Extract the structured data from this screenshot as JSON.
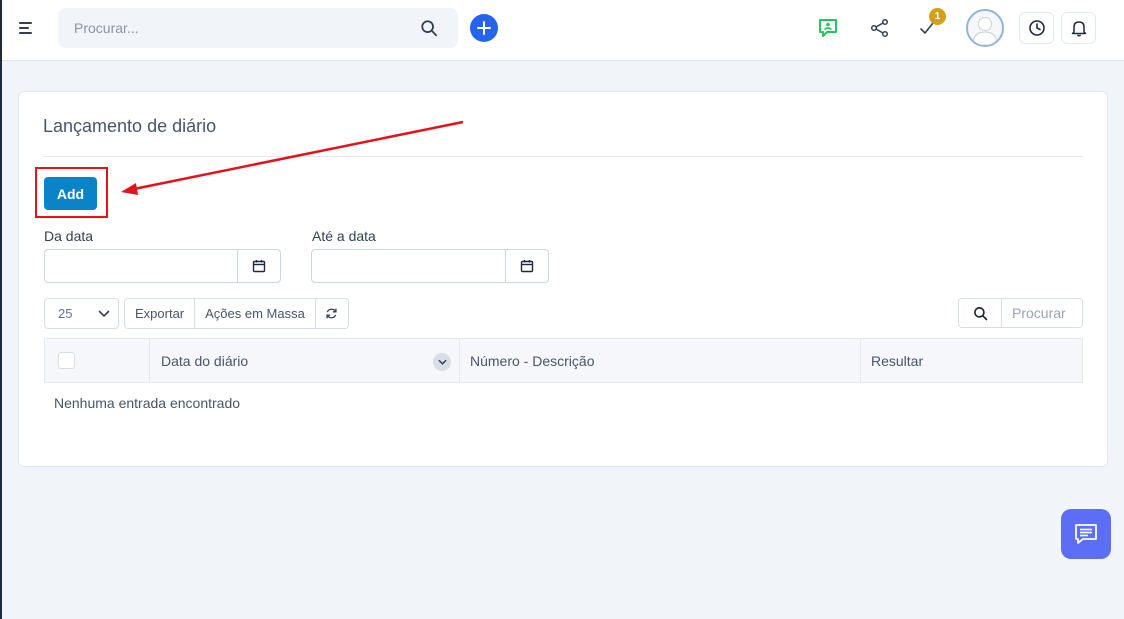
{
  "topbar": {
    "search_placeholder": "Procurar...",
    "notification_count": "1"
  },
  "card": {
    "title": "Lançamento de diário",
    "add_label": "Add",
    "from_date_label": "Da data",
    "to_date_label": "Até a data",
    "page_length": "25",
    "export_label": "Exportar",
    "bulk_actions_label": "Ações em Massa",
    "search_placeholder": "Procurar",
    "columns": [
      "Data do diário",
      "Número - Descrição",
      "Resultar"
    ],
    "empty_message": "Nenhuma entrada encontrado"
  },
  "colors": {
    "accent": "#0b84c7",
    "plus": "#2563eb",
    "highlight": "#e0141b",
    "badge": "#d4a017",
    "chat": "#5b6ef5",
    "chat_icon_green": "#22c55e"
  },
  "icons": [
    "menu-icon",
    "search-icon",
    "plus-icon",
    "chat-support-icon",
    "share-icon",
    "check-icon",
    "clock-icon",
    "bell-icon",
    "calendar-icon",
    "refresh-icon",
    "chevron-down-icon",
    "message-icon"
  ]
}
